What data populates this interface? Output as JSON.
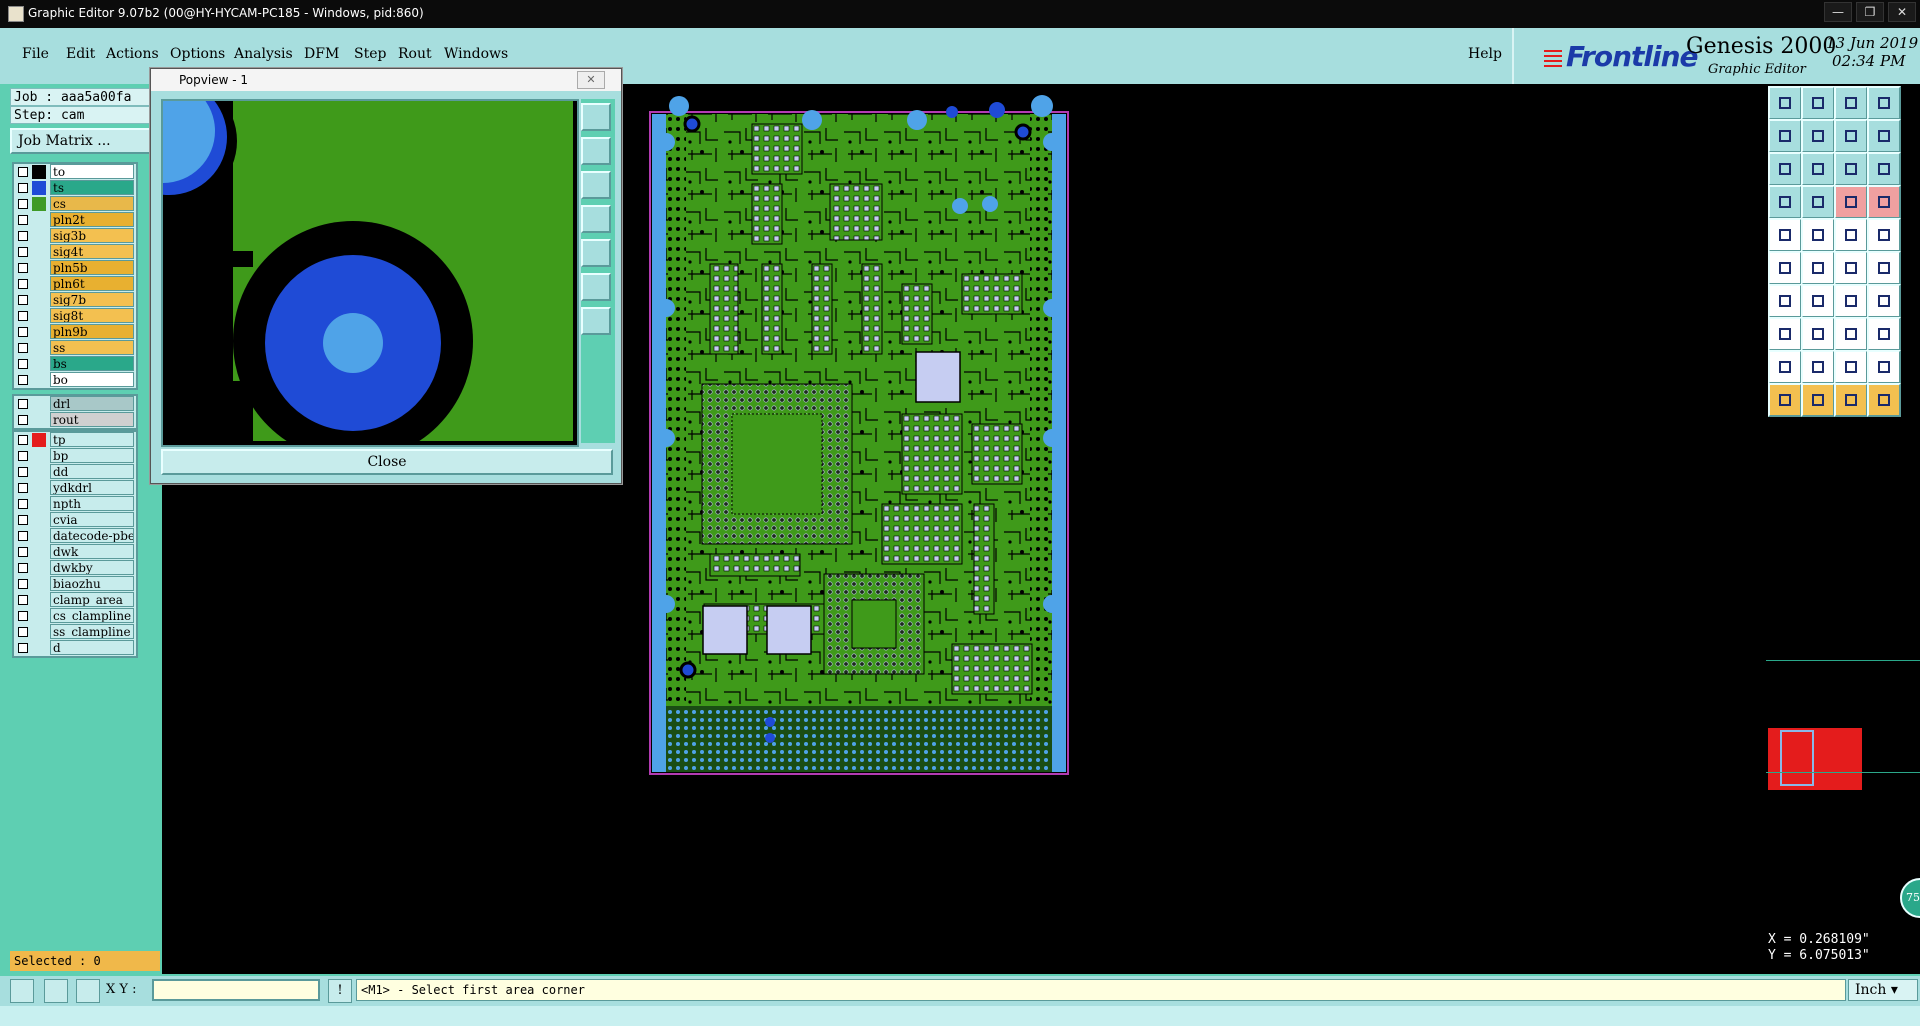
{
  "window": {
    "title": "Graphic Editor 9.07b2 (00@HY-HYCAM-PC185 - Windows, pid:860)",
    "min": "—",
    "max": "❐",
    "close": "✕"
  },
  "menu": {
    "items": [
      "File",
      "Edit",
      "Actions",
      "Options",
      "Analysis",
      "DFM",
      "Step",
      "Rout",
      "Windows"
    ],
    "help": "Help"
  },
  "brand": {
    "logo": "Frontline",
    "product": "Genesis 2000",
    "subtitle": "Graphic Editor",
    "date": "13 Jun 2019",
    "time": "02:34 PM"
  },
  "left": {
    "job": "Job : aaa5a00fa",
    "step": "Step: cam",
    "job_matrix": "Job Matrix ...",
    "selected": "Selected : 0",
    "layers_board": [
      {
        "name": "to",
        "swatch": "#000000",
        "bg": "#ffffff"
      },
      {
        "name": "ts",
        "swatch": "#1f4bd6",
        "bg": "#2aa88a"
      },
      {
        "name": "cs",
        "swatch": "#3f9a26",
        "bg": "#e8b84a"
      },
      {
        "name": "pln2t",
        "swatch": "",
        "bg": "#e8b030"
      },
      {
        "name": "sig3b",
        "swatch": "",
        "bg": "#f3c050"
      },
      {
        "name": "sig4t",
        "swatch": "",
        "bg": "#f3c050"
      },
      {
        "name": "pln5b",
        "swatch": "",
        "bg": "#e8b030"
      },
      {
        "name": "pln6t",
        "swatch": "",
        "bg": "#e8b030"
      },
      {
        "name": "sig7b",
        "swatch": "",
        "bg": "#f3c050"
      },
      {
        "name": "sig8t",
        "swatch": "",
        "bg": "#f3c050"
      },
      {
        "name": "pln9b",
        "swatch": "",
        "bg": "#e8b030"
      },
      {
        "name": "ss",
        "swatch": "",
        "bg": "#f3c050"
      },
      {
        "name": "bs",
        "swatch": "",
        "bg": "#2aa88a"
      },
      {
        "name": "bo",
        "swatch": "",
        "bg": "#ffffff"
      }
    ],
    "layers_drill": [
      {
        "name": "drl",
        "swatch": "",
        "bg": "#a8c8c8"
      },
      {
        "name": "rout",
        "swatch": "",
        "bg": "#d0d0d0"
      }
    ],
    "layers_misc": [
      {
        "name": "tp",
        "swatch": "#e41c1c",
        "bg": "#c7ecec"
      },
      {
        "name": "bp",
        "swatch": "",
        "bg": "#c7ecec"
      },
      {
        "name": "dd",
        "swatch": "",
        "bg": "#c7ecec"
      },
      {
        "name": "ydkdrl",
        "swatch": "",
        "bg": "#c7ecec"
      },
      {
        "name": "npth",
        "swatch": "",
        "bg": "#c7ecec"
      },
      {
        "name": "cvia",
        "swatch": "",
        "bg": "#c7ecec"
      },
      {
        "name": "datecode-pbe",
        "swatch": "",
        "bg": "#c7ecec"
      },
      {
        "name": "dwk",
        "swatch": "",
        "bg": "#c7ecec"
      },
      {
        "name": "dwkby",
        "swatch": "",
        "bg": "#c7ecec"
      },
      {
        "name": "biaozhu",
        "swatch": "",
        "bg": "#c7ecec"
      },
      {
        "name": "clamp_area",
        "swatch": "",
        "bg": "#c7ecec"
      },
      {
        "name": "cs_clampline",
        "swatch": "",
        "bg": "#c7ecec"
      },
      {
        "name": "ss_clampline",
        "swatch": "",
        "bg": "#c7ecec"
      },
      {
        "name": "d",
        "swatch": "",
        "bg": "#c7ecec"
      }
    ]
  },
  "popview": {
    "title": "Popview - 1",
    "close_label": "Close"
  },
  "bottom": {
    "xy_label": "X Y :",
    "xy_value": "",
    "status": "<M1> - Select first area corner",
    "units": "Inch"
  },
  "coords": {
    "x": "X = 0.268109\"",
    "y": "Y = 6.075013\""
  },
  "zoom_badge": "75"
}
